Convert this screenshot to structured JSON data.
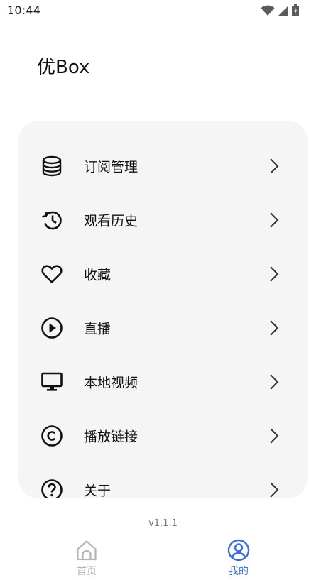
{
  "status_bar": {
    "time": "10:44",
    "icons": [
      "wifi-icon",
      "signal-icon",
      "battery-icon"
    ]
  },
  "app": {
    "title": "优Box"
  },
  "menu": {
    "items": [
      {
        "label": "订阅管理",
        "icon": "database-icon"
      },
      {
        "label": "观看历史",
        "icon": "history-icon"
      },
      {
        "label": "收藏",
        "icon": "heart-icon"
      },
      {
        "label": "直播",
        "icon": "play-circle-icon"
      },
      {
        "label": "本地视频",
        "icon": "monitor-icon"
      },
      {
        "label": "播放链接",
        "icon": "copyright-icon"
      },
      {
        "label": "关于",
        "icon": "help-circle-icon"
      }
    ]
  },
  "version": "v1.1.1",
  "bottom_nav": {
    "tabs": [
      {
        "label": "首页",
        "icon": "home-icon",
        "active": false
      },
      {
        "label": "我的",
        "icon": "user-circle-icon",
        "active": true
      }
    ]
  },
  "colors": {
    "accent": "#3a6fd6",
    "card_background": "#f5f5f5",
    "inactive_tab": "#b5b5b5"
  }
}
